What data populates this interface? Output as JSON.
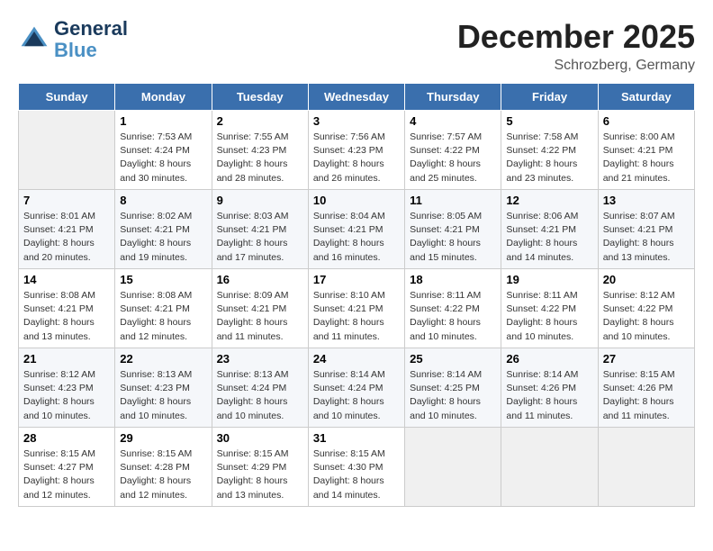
{
  "header": {
    "logo_line1": "General",
    "logo_line2": "Blue",
    "month": "December 2025",
    "location": "Schrozberg, Germany"
  },
  "weekdays": [
    "Sunday",
    "Monday",
    "Tuesday",
    "Wednesday",
    "Thursday",
    "Friday",
    "Saturday"
  ],
  "weeks": [
    [
      {
        "day": "",
        "info": ""
      },
      {
        "day": "1",
        "info": "Sunrise: 7:53 AM\nSunset: 4:24 PM\nDaylight: 8 hours\nand 30 minutes."
      },
      {
        "day": "2",
        "info": "Sunrise: 7:55 AM\nSunset: 4:23 PM\nDaylight: 8 hours\nand 28 minutes."
      },
      {
        "day": "3",
        "info": "Sunrise: 7:56 AM\nSunset: 4:23 PM\nDaylight: 8 hours\nand 26 minutes."
      },
      {
        "day": "4",
        "info": "Sunrise: 7:57 AM\nSunset: 4:22 PM\nDaylight: 8 hours\nand 25 minutes."
      },
      {
        "day": "5",
        "info": "Sunrise: 7:58 AM\nSunset: 4:22 PM\nDaylight: 8 hours\nand 23 minutes."
      },
      {
        "day": "6",
        "info": "Sunrise: 8:00 AM\nSunset: 4:21 PM\nDaylight: 8 hours\nand 21 minutes."
      }
    ],
    [
      {
        "day": "7",
        "info": "Sunrise: 8:01 AM\nSunset: 4:21 PM\nDaylight: 8 hours\nand 20 minutes."
      },
      {
        "day": "8",
        "info": "Sunrise: 8:02 AM\nSunset: 4:21 PM\nDaylight: 8 hours\nand 19 minutes."
      },
      {
        "day": "9",
        "info": "Sunrise: 8:03 AM\nSunset: 4:21 PM\nDaylight: 8 hours\nand 17 minutes."
      },
      {
        "day": "10",
        "info": "Sunrise: 8:04 AM\nSunset: 4:21 PM\nDaylight: 8 hours\nand 16 minutes."
      },
      {
        "day": "11",
        "info": "Sunrise: 8:05 AM\nSunset: 4:21 PM\nDaylight: 8 hours\nand 15 minutes."
      },
      {
        "day": "12",
        "info": "Sunrise: 8:06 AM\nSunset: 4:21 PM\nDaylight: 8 hours\nand 14 minutes."
      },
      {
        "day": "13",
        "info": "Sunrise: 8:07 AM\nSunset: 4:21 PM\nDaylight: 8 hours\nand 13 minutes."
      }
    ],
    [
      {
        "day": "14",
        "info": "Sunrise: 8:08 AM\nSunset: 4:21 PM\nDaylight: 8 hours\nand 13 minutes."
      },
      {
        "day": "15",
        "info": "Sunrise: 8:08 AM\nSunset: 4:21 PM\nDaylight: 8 hours\nand 12 minutes."
      },
      {
        "day": "16",
        "info": "Sunrise: 8:09 AM\nSunset: 4:21 PM\nDaylight: 8 hours\nand 11 minutes."
      },
      {
        "day": "17",
        "info": "Sunrise: 8:10 AM\nSunset: 4:21 PM\nDaylight: 8 hours\nand 11 minutes."
      },
      {
        "day": "18",
        "info": "Sunrise: 8:11 AM\nSunset: 4:22 PM\nDaylight: 8 hours\nand 10 minutes."
      },
      {
        "day": "19",
        "info": "Sunrise: 8:11 AM\nSunset: 4:22 PM\nDaylight: 8 hours\nand 10 minutes."
      },
      {
        "day": "20",
        "info": "Sunrise: 8:12 AM\nSunset: 4:22 PM\nDaylight: 8 hours\nand 10 minutes."
      }
    ],
    [
      {
        "day": "21",
        "info": "Sunrise: 8:12 AM\nSunset: 4:23 PM\nDaylight: 8 hours\nand 10 minutes."
      },
      {
        "day": "22",
        "info": "Sunrise: 8:13 AM\nSunset: 4:23 PM\nDaylight: 8 hours\nand 10 minutes."
      },
      {
        "day": "23",
        "info": "Sunrise: 8:13 AM\nSunset: 4:24 PM\nDaylight: 8 hours\nand 10 minutes."
      },
      {
        "day": "24",
        "info": "Sunrise: 8:14 AM\nSunset: 4:24 PM\nDaylight: 8 hours\nand 10 minutes."
      },
      {
        "day": "25",
        "info": "Sunrise: 8:14 AM\nSunset: 4:25 PM\nDaylight: 8 hours\nand 10 minutes."
      },
      {
        "day": "26",
        "info": "Sunrise: 8:14 AM\nSunset: 4:26 PM\nDaylight: 8 hours\nand 11 minutes."
      },
      {
        "day": "27",
        "info": "Sunrise: 8:15 AM\nSunset: 4:26 PM\nDaylight: 8 hours\nand 11 minutes."
      }
    ],
    [
      {
        "day": "28",
        "info": "Sunrise: 8:15 AM\nSunset: 4:27 PM\nDaylight: 8 hours\nand 12 minutes."
      },
      {
        "day": "29",
        "info": "Sunrise: 8:15 AM\nSunset: 4:28 PM\nDaylight: 8 hours\nand 12 minutes."
      },
      {
        "day": "30",
        "info": "Sunrise: 8:15 AM\nSunset: 4:29 PM\nDaylight: 8 hours\nand 13 minutes."
      },
      {
        "day": "31",
        "info": "Sunrise: 8:15 AM\nSunset: 4:30 PM\nDaylight: 8 hours\nand 14 minutes."
      },
      {
        "day": "",
        "info": ""
      },
      {
        "day": "",
        "info": ""
      },
      {
        "day": "",
        "info": ""
      }
    ]
  ]
}
